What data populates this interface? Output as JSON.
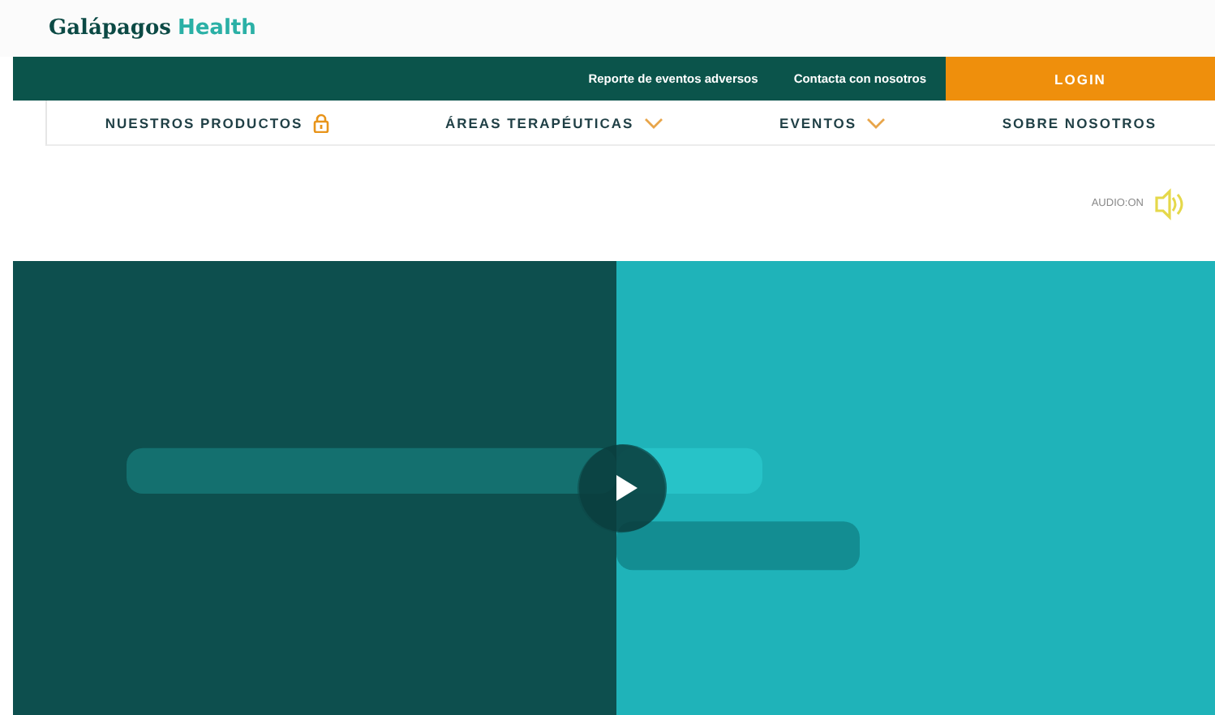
{
  "logo": {
    "brand": "Galápagos",
    "product": "Health"
  },
  "top_bar": {
    "links": [
      "Reporte de eventos adversos",
      "Contacta con nosotros"
    ],
    "login": "LOGIN"
  },
  "nav": [
    {
      "label": "NUESTROS PRODUCTOS",
      "kind": "lock"
    },
    {
      "label": "ÁREAS TERAPÉUTICAS",
      "kind": "dropdown"
    },
    {
      "label": "EVENTOS",
      "kind": "dropdown"
    },
    {
      "label": "SOBRE NOSOTROS",
      "kind": "plain"
    }
  ],
  "audio": {
    "label": "AUDIO:ON",
    "on": true
  }
}
